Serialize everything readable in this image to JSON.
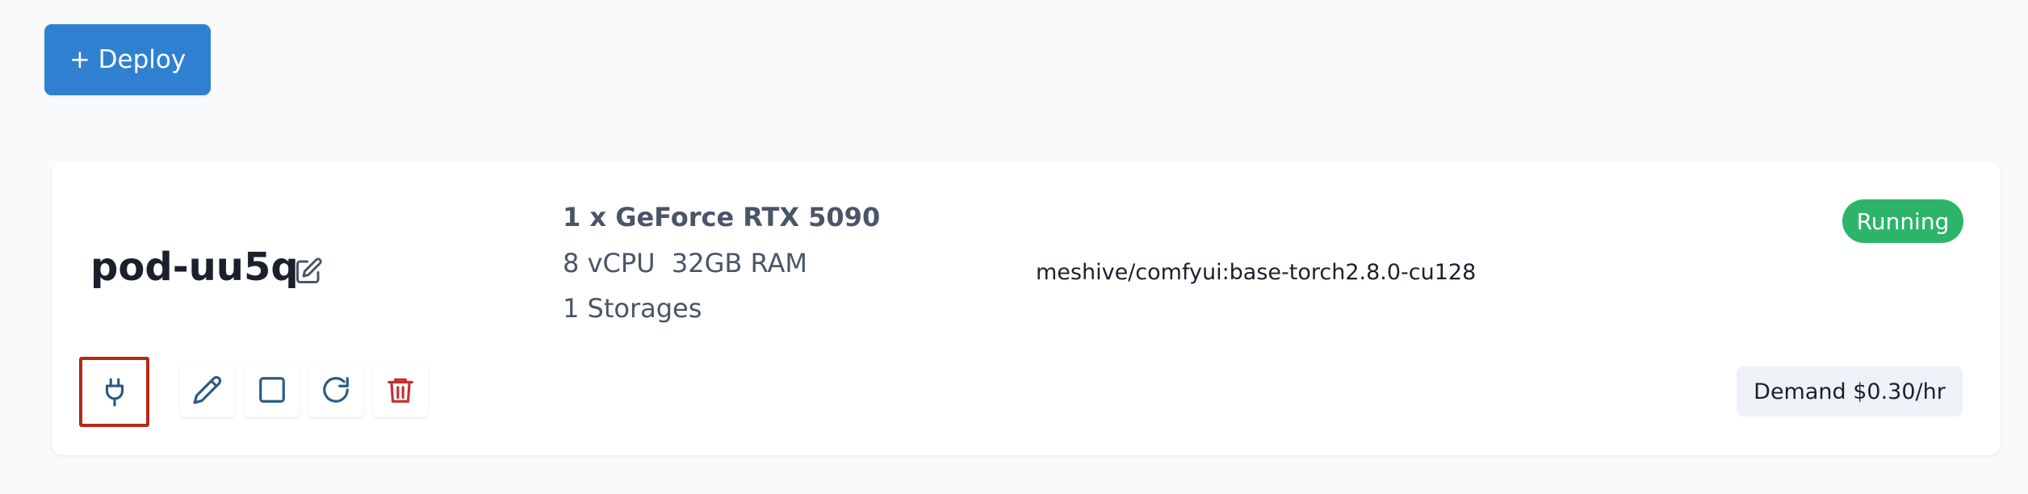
{
  "toolbar": {
    "deploy_label": "+ Deploy",
    "accent": "#2f80d1"
  },
  "pod": {
    "name": "pod-uu5q",
    "gpu": "1 x GeForce RTX 5090",
    "cpu_ram": "8 vCPU  32GB RAM",
    "storages": "1 Storages",
    "image": "meshive/comfyui:base-torch2.8.0-cu128",
    "status": "Running",
    "status_color": "#2cb56a",
    "price": "Demand $0.30/hr",
    "actions": [
      {
        "name": "connect",
        "icon": "plug-icon",
        "color": "#2b5b84"
      },
      {
        "name": "edit",
        "icon": "pencil-icon",
        "color": "#2b5b84"
      },
      {
        "name": "stop",
        "icon": "square-icon",
        "color": "#2b5b84"
      },
      {
        "name": "restart",
        "icon": "refresh-icon",
        "color": "#2b5b84"
      },
      {
        "name": "delete",
        "icon": "trash-icon",
        "color": "#c53030"
      }
    ],
    "highlight_color": "#b52a1a"
  }
}
